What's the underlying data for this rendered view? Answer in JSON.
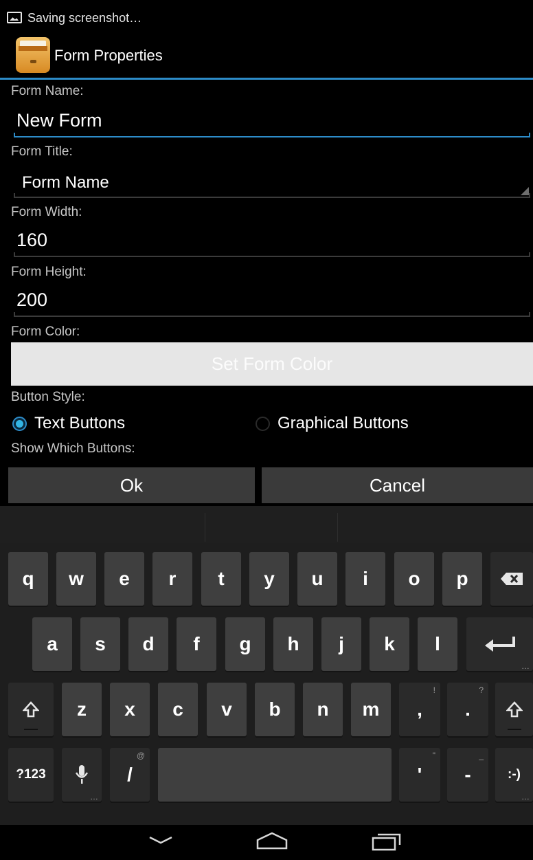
{
  "status_bar": {
    "notification_text": "Saving screenshot…"
  },
  "action_bar": {
    "title": "Form Properties"
  },
  "form": {
    "name_label": "Form Name:",
    "name_value": "New Form",
    "title_label": "Form Title:",
    "title_value": "Form Name",
    "width_label": "Form Width:",
    "width_value": "160",
    "height_label": "Form Height:",
    "height_value": "200",
    "color_label": "Form Color:",
    "color_button": "Set Form Color",
    "button_style_label": "Button Style:",
    "button_style_options": [
      {
        "label": "Text Buttons",
        "selected": true
      },
      {
        "label": "Graphical Buttons",
        "selected": false
      }
    ],
    "show_buttons_label": "Show Which Buttons:"
  },
  "dialog_buttons": {
    "ok": "Ok",
    "cancel": "Cancel"
  },
  "keyboard": {
    "row1": [
      "q",
      "w",
      "e",
      "r",
      "t",
      "y",
      "u",
      "i",
      "o",
      "p"
    ],
    "row2": [
      "a",
      "s",
      "d",
      "f",
      "g",
      "h",
      "j",
      "k",
      "l"
    ],
    "row3": [
      "z",
      "x",
      "c",
      "v",
      "b",
      "n",
      "m",
      ",",
      "."
    ],
    "row3_hints": {
      ",": "!",
      ".": "?"
    },
    "row4": {
      "symbols": "?123",
      "slash": "/",
      "slash_hint": "@",
      "apostrophe": "'",
      "apostrophe_hint": "\"",
      "dash": "-",
      "dash_hint": "_",
      "smiley": ":-)"
    }
  },
  "colors": {
    "accent": "#33b5e5",
    "background": "#000000",
    "key": "#3f3f3f"
  }
}
